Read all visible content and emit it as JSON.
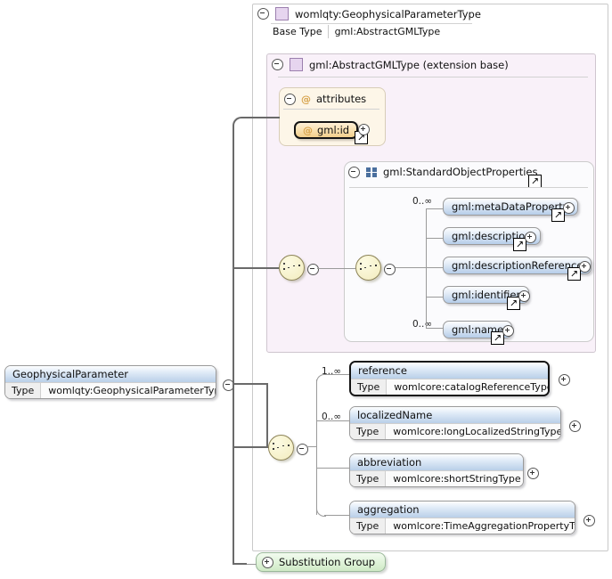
{
  "diagram": {
    "title": "womlqty:GeophysicalParameterType",
    "base_type_key": "Base Type",
    "base_type_value": "gml:AbstractGMLType",
    "extension_base_label": "gml:AbstractGMLType (extension base)",
    "attributes_group_label": "attributes",
    "attribute": {
      "name": "gml:id",
      "at_glyph": "@"
    },
    "standard_object_properties_label": "gml:StandardObjectProperties",
    "substitution_group_label": "Substitution Group",
    "root_element": {
      "name": "GeophysicalParameter",
      "type_key": "Type",
      "type_value": "womlqty:GeophysicalParameterType"
    },
    "gml_properties": [
      {
        "name": "gml:metaDataProperty",
        "cardinality": "0..∞"
      },
      {
        "name": "gml:description",
        "cardinality": ""
      },
      {
        "name": "gml:descriptionReference",
        "cardinality": ""
      },
      {
        "name": "gml:identifier",
        "cardinality": ""
      },
      {
        "name": "gml:name",
        "cardinality": "0..∞"
      }
    ],
    "child_elements": [
      {
        "name": "reference",
        "type_key": "Type",
        "type_value": "womlcore:catalogReferenceType",
        "cardinality": "1..∞",
        "required": true
      },
      {
        "name": "localizedName",
        "type_key": "Type",
        "type_value": "womlcore:longLocalizedStringType",
        "cardinality": "0..∞",
        "required": false
      },
      {
        "name": "abbreviation",
        "type_key": "Type",
        "type_value": "womlcore:shortStringType",
        "cardinality": "",
        "required": false
      },
      {
        "name": "aggregation",
        "type_key": "Type",
        "type_value": "womlcore:TimeAggregationPropertyType",
        "cardinality": "",
        "required": false
      }
    ],
    "icons": {
      "collapse": "minus-circle",
      "expand": "plus-circle",
      "external_ref": "↗",
      "sequence": "sequence-compositor"
    },
    "colors": {
      "base_panel": "#f9f1f9",
      "attributes_panel": "#fdf6e8",
      "element_header": "#b9cfe8",
      "attribute_fill": "#f2cf8c",
      "substitution_group": "#cfeac6",
      "sequence_compositor": "#f2ecbe"
    }
  }
}
